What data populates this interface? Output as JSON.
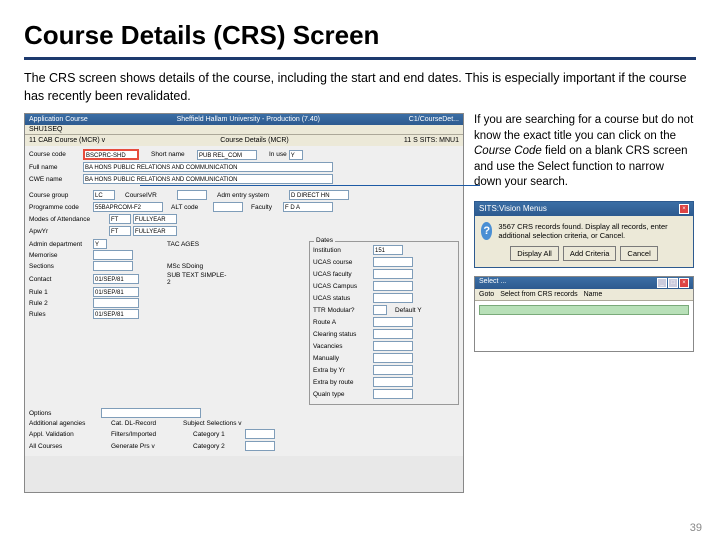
{
  "title": "Course Details (CRS) Screen",
  "description": "The CRS screen shows details of the course, including the start and end dates. This is especially important if the course has recently been revalidated.",
  "side_text_1": "If you are searching for a course but do not know the exact title you can click on the ",
  "side_text_em": "Course Code",
  "side_text_2": " field on a blank CRS screen and use the Select function to narrow down your search.",
  "app": {
    "titlebar_left": "Application Course",
    "titlebar_center": "Sheffield Hallam University - Production (7.40)",
    "titlebar_right": "C1/CourseDet...",
    "menubar": "SHU1SEQ",
    "header_left": "11  CAB Course (MCR) v",
    "header_center": "Course Details (MCR)",
    "header_right": "11  S SITS: MNU1",
    "codes": {
      "course_code_lbl": "Course code",
      "course_code_val": "BSCPRC-SHD",
      "short_name_lbl": "Short name",
      "short_name_val": "PUB REL_COM",
      "in_use_lbl": "In use",
      "in_use_val": "Y",
      "full_name_lbl": "Full name",
      "full_name_val": "BA HONS PUBLIC RELATIONS AND COMMUNICATION",
      "cwe_name_lbl": "CWE name",
      "cwe_name_val": "BA HONS PUBLIC RELATIONS AND COMMUNICATION"
    },
    "sect2": {
      "crs_group_lbl": "Course group",
      "crs_group_val": "LC",
      "course_ivr_lbl": "CourseIVR",
      "adm_entry_lbl": "Adm entry system",
      "adm_entry_val": "D  DIRECT HN",
      "prog_code_lbl": "Programme code",
      "prog_code_val": "55BAPRCOM-F2",
      "alt_code_lbl": "ALT code",
      "faculty_lbl": "Faculty",
      "faculty_val": "F  D  A",
      "moa_lbl": "Modes of Attendance",
      "moa_val1": "FT",
      "moa_val2": "FULLYEAR",
      "apw_lbl": "ApwYr",
      "apw_val1": "FT",
      "apw_val2": "FULLYEAR"
    },
    "dates_title": "Dates",
    "dates": {
      "inst_lbl": "Institution",
      "inst_val": "151",
      "ucas_course_lbl": "UCAS course",
      "ucas_faculty_lbl": "UCAS faculty",
      "ucas_campus_lbl": "UCAS Campus",
      "ucas_status_lbl": "UCAS status",
      "ttr_lbl": "TTR Modular?",
      "route_lbl": "Route A",
      "clearing_lbl": "Clearing status",
      "vacancies_lbl": "Vacancies",
      "manually_lbl": "Manually",
      "extra_lbl": "Extra by Yr",
      "extra2_lbl": "Extra by route",
      "qtype_lbl": "Qualn type",
      "admin_lbl": "Admin department",
      "admin_val": "Y",
      "msc_lbl": "MSc SDoing",
      "memo_lbl": "Memorise",
      "sections_lbl": "Sections",
      "contact_lbl": "Contact",
      "contact_val": "01/SEP/81",
      "sub_lbl": "SUB TEXT SIMPLE-2",
      "rule1_lbl": "Rule 1",
      "rule1_val": "01/SEP/81",
      "rule2_lbl": "Rule 2",
      "rules_lbl": "Rules",
      "rules_val": "01/SEP/81",
      "default_lbl": "Default  Y",
      "tac_lbl": "TAC AGES"
    },
    "bottom": {
      "opt_lbl": "Options",
      "addl_lbl": "Additional agencies",
      "appl_lbl": "Appl. Validation",
      "all_lbl": "All Courses",
      "cat_lbl": "Cat. DL-Record",
      "sub_sel_lbl": "Subject Selections v",
      "filter_lbl": "Filters/Imported",
      "gen_lbl": "Generate Prs v",
      "cat1_lbl": "Category 1",
      "cat2_lbl": "Category 2"
    }
  },
  "dialog1": {
    "title": "SITS:Vision Menus",
    "msg": "3567 CRS records found. Display all records, enter additional selection criteria, or Cancel.",
    "btn1": "Display All",
    "btn2": "Add Criteria",
    "btn3": "Cancel"
  },
  "dialog2": {
    "title": "Select ...",
    "btn_close": "×",
    "tb1": "Goto",
    "tb2": "Select from CRS records",
    "tb3": "Name"
  },
  "pagenum": "39"
}
